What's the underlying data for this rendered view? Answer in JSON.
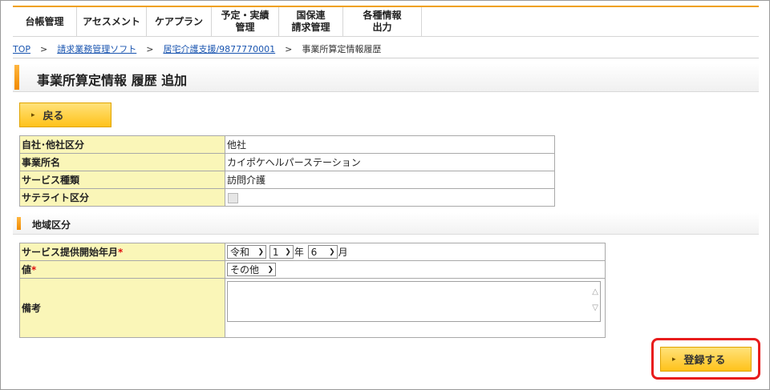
{
  "nav": {
    "items": [
      "台帳管理",
      "アセスメント",
      "ケアプラン",
      "予定・実績\n管理",
      "国保連\n請求管理",
      "各種情報\n出力"
    ]
  },
  "breadcrumb": {
    "top": "TOP",
    "software": "請求業務管理ソフト",
    "office": "居宅介護支援/9877770001",
    "current": "事業所算定情報履歴",
    "separator": ">"
  },
  "page": {
    "title": "事業所算定情報 履歴 追加"
  },
  "buttons": {
    "back": "戻る",
    "register": "登録する"
  },
  "info_table": {
    "own_other": {
      "label": "自社･他社区分",
      "value": "他社"
    },
    "office_name": {
      "label": "事業所名",
      "value": "カイポケヘルパーステーション"
    },
    "service_type": {
      "label": "サービス種類",
      "value": "訪問介護"
    },
    "satellite": {
      "label": "サテライト区分",
      "checked": false
    }
  },
  "section": {
    "title": "地域区分"
  },
  "form": {
    "start_date": {
      "label": "サービス提供開始年月",
      "required_mark": "*",
      "era": "令和",
      "year": "1",
      "year_unit": "年",
      "month": "6",
      "month_unit": "月"
    },
    "value": {
      "label": "値",
      "required_mark": "*",
      "selected": "その他"
    },
    "remarks": {
      "label": "備考",
      "value": ""
    }
  },
  "colors": {
    "accent": "#f0a010",
    "label_bg": "#faf6b8",
    "button_bg": "#ffc21a",
    "highlight": "#e81c1c",
    "link": "#1a55b0"
  }
}
